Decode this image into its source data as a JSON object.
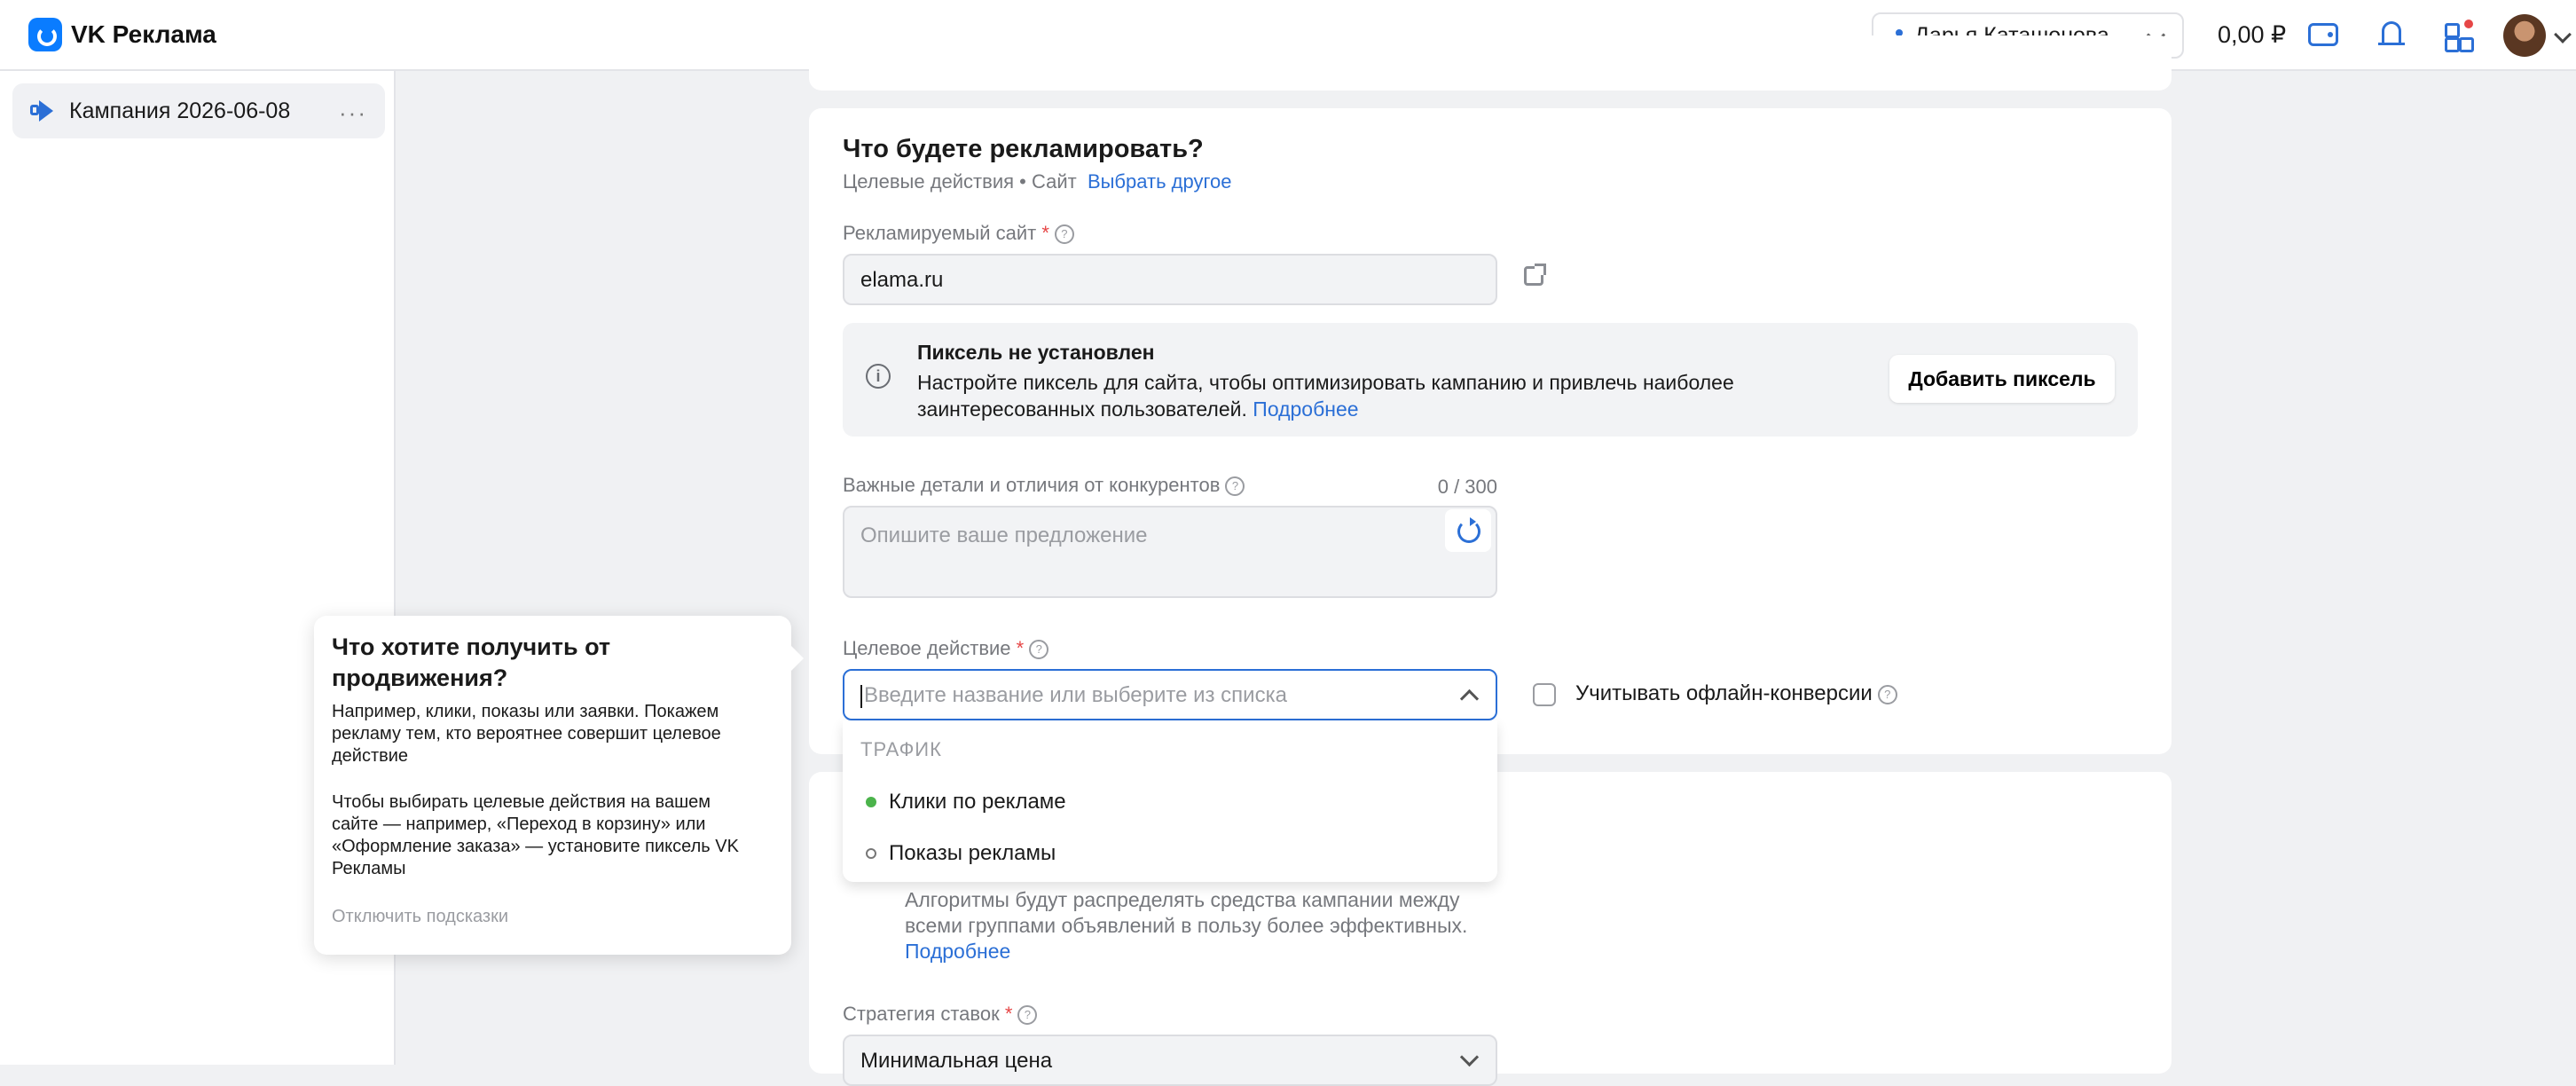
{
  "app": {
    "title": "VK Реклама"
  },
  "header": {
    "account_name": "Дарья Каташонова",
    "balance": "0,00 ₽"
  },
  "sidebar": {
    "items": [
      {
        "label": "Кампания 2026-06-08",
        "more": "···"
      }
    ]
  },
  "section": {
    "title": "Что будете рекламировать?",
    "subtitle": "Целевые действия • Сайт",
    "change_link": "Выбрать другое",
    "site_label": "Рекламируемый сайт",
    "required_mark": "*",
    "site_value": "elama.ru",
    "pixel": {
      "title": "Пиксель не установлен",
      "text": "Настройте пиксель для сайта, чтобы оптимизировать кампанию и привлечь наиболее заинтересованных пользователей.",
      "more_link": "Подробнее",
      "add_button": "Добавить пиксель"
    },
    "details_label": "Важные детали и отличия от конкурентов",
    "details_counter": "0 / 300",
    "details_placeholder": "Опишите ваше предложение",
    "target_label": "Целевое действие",
    "target_placeholder": "Введите название или выберите из списка",
    "offline_label": "Учитывать офлайн-конверсии"
  },
  "dropdown": {
    "group": "ТРАФИК",
    "options": [
      "Клики по рекламе",
      "Показы рекламы"
    ]
  },
  "strategy": {
    "text": "Алгоритмы будут распределять средства кампании между всеми группами объявлений в пользу более эффективных.",
    "more_link": "Подробнее",
    "bid_label": "Стратегия ставок",
    "bid_value": "Минимальная цена"
  },
  "tooltip": {
    "title": "Что хотите получить от продвижения?",
    "p1": "Например, клики, показы или заявки. Покажем рекламу тем, кто вероятнее совершит целевое действие",
    "p2": "Чтобы выбирать целевые действия на вашем сайте — например, «Переход в корзину» или «Оформление заказа» — установите пиксель VK Рекламы",
    "disable_link": "Отключить подсказки"
  },
  "icons": {
    "help": "?",
    "info": "i"
  },
  "colors": {
    "accent": "#2b6fd6",
    "required": "#e64646",
    "selected_dot": "#4bb34b"
  }
}
